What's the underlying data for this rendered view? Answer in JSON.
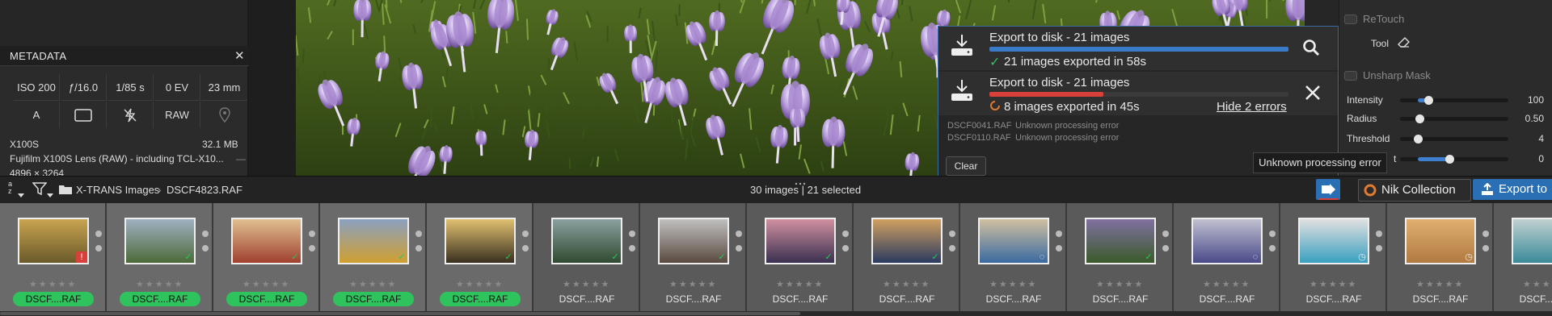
{
  "metadata": {
    "title": "METADATA",
    "grid_row1": [
      "ISO 200",
      "ƒ/16.0",
      "1/85 s",
      "0 EV",
      "23 mm"
    ],
    "grid_row2_text": [
      "A",
      "RAW"
    ],
    "camera": "X100S",
    "size": "32.1 MB",
    "lens": "Fujifilm X100S Lens (RAW) - including TCL-X10...",
    "lens_dash": "—",
    "dimensions": "4896 × 3264"
  },
  "export_panel": {
    "job1_title": "Export to disk - 21 images",
    "job1_status": "21 images exported in 58s",
    "job2_title": "Export to disk - 21 images",
    "job2_status": "8 images exported in 45s",
    "hide_errors": "Hide 2 errors",
    "errors": [
      {
        "file": "DSCF0041.RAF",
        "message": "Unknown processing error"
      },
      {
        "file": "DSCF0110.RAF",
        "message": "Unknown processing error"
      }
    ],
    "clear_label": "Clear",
    "tooltip": "Unknown processing error",
    "job1_progress": 1.0,
    "job2_progress": 0.38,
    "colors": {
      "success": "#2fc35d",
      "error": "#d9403a",
      "progress_blue": "#3a7bc8"
    }
  },
  "right_panel": {
    "retouch_label": "ReTouch",
    "tool_label": "Tool",
    "unsharp_label": "Unsharp Mask",
    "sliders": [
      {
        "label": "Intensity",
        "value": "100",
        "level": 0.12
      },
      {
        "label": "Radius",
        "value": "0.50",
        "level": 0.02
      },
      {
        "label": "Threshold",
        "value": "4",
        "level": 0.0
      },
      {
        "label": "t",
        "value": "0",
        "level": 0.35
      }
    ]
  },
  "toolbar": {
    "sort_label": "a z",
    "folder_name": "X-TRANS Images",
    "file_name": "DSCF4823.RAF",
    "selection_summary": "30 images | 21 selected",
    "nik_label": "Nik Collection",
    "export_label": "Export to"
  },
  "filmstrip": {
    "stars": "★★★★★",
    "thumbs": [
      {
        "name": "DSCF....RAF",
        "pill": true,
        "badge": "error",
        "palette": [
          "#6a5a2a",
          "#c9a450"
        ]
      },
      {
        "name": "DSCF....RAF",
        "pill": true,
        "badge": "check",
        "palette": [
          "#4c6a3a",
          "#a0b0c0"
        ]
      },
      {
        "name": "DSCF....RAF",
        "pill": true,
        "badge": "check",
        "palette": [
          "#a04030",
          "#e0c090"
        ]
      },
      {
        "name": "DSCF....RAF",
        "pill": true,
        "badge": "check",
        "palette": [
          "#d0a030",
          "#8aa0c0"
        ]
      },
      {
        "name": "DSCF....RAF",
        "pill": true,
        "badge": "check",
        "palette": [
          "#3a3020",
          "#e0c070"
        ]
      },
      {
        "name": "DSCF....RAF",
        "pill": false,
        "badge": "check",
        "palette": [
          "#304a30",
          "#8aa0a0"
        ]
      },
      {
        "name": "DSCF....RAF",
        "pill": false,
        "badge": "check",
        "palette": [
          "#5a4a40",
          "#c0c0c0"
        ]
      },
      {
        "name": "DSCF....RAF",
        "pill": false,
        "badge": "check",
        "palette": [
          "#3a3050",
          "#d090a0"
        ]
      },
      {
        "name": "DSCF....RAF",
        "pill": false,
        "badge": "check",
        "palette": [
          "#2a3a60",
          "#d0a060"
        ]
      },
      {
        "name": "DSCF....RAF",
        "pill": false,
        "badge": "progress",
        "palette": [
          "#3a6aa0",
          "#d0c0a0"
        ]
      },
      {
        "name": "DSCF....RAF",
        "pill": false,
        "badge": "check",
        "palette": [
          "#3a5a2a",
          "#8070a0"
        ]
      },
      {
        "name": "DSCF....RAF",
        "pill": false,
        "badge": "progress",
        "palette": [
          "#4a4a8a",
          "#c0c0d0"
        ]
      },
      {
        "name": "DSCF....RAF",
        "pill": false,
        "badge": "clock",
        "palette": [
          "#3aa0c0",
          "#e0e0e0"
        ]
      },
      {
        "name": "DSCF....RAF",
        "pill": false,
        "badge": "clock",
        "palette": [
          "#b07a40",
          "#e0b070"
        ]
      },
      {
        "name": "DSCF....RAF",
        "pill": false,
        "badge": "none",
        "palette": [
          "#3a8a9a",
          "#c0d0d0"
        ]
      }
    ]
  }
}
